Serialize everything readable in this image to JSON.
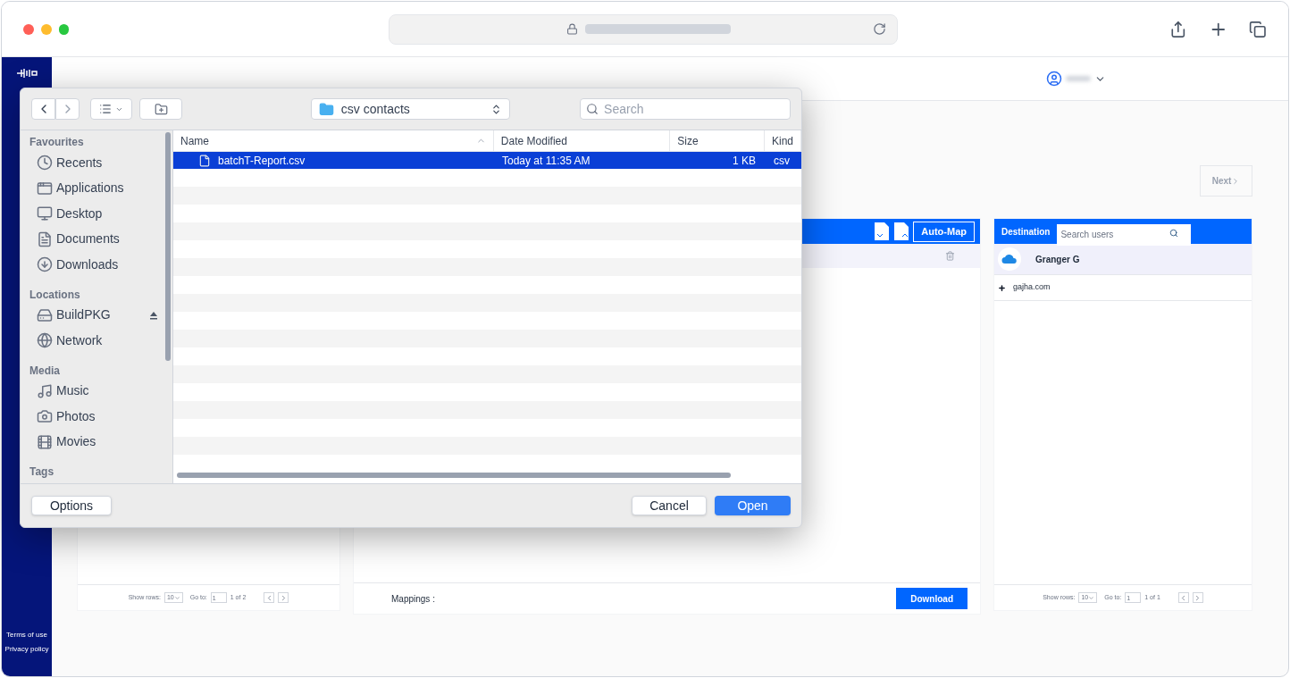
{
  "browser": {
    "address_bar": {
      "secure": true
    }
  },
  "sidebar": {
    "links": [
      "Terms of use",
      "Privacy policy"
    ]
  },
  "header": {
    "user_menu": {
      "expanded": false
    }
  },
  "next_button": {
    "label": "Next",
    "disabled": true
  },
  "source_panel": {
    "pagination": {
      "show_rows_label": "Show rows:",
      "rows": "10",
      "goto_label": "Go to:",
      "page": "1",
      "of": "1 of 2"
    }
  },
  "mapping_panel": {
    "auto_map_label": "Auto-Map",
    "mappings_label": "Mappings :",
    "download_label": "Download"
  },
  "destination_panel": {
    "title": "Destination",
    "search": {
      "placeholder": "Search users"
    },
    "rows": [
      {
        "kind": "user",
        "label": "Granger G",
        "selected": true
      },
      {
        "kind": "domain",
        "label": "gajha.com",
        "selected": false
      }
    ],
    "pagination": {
      "show_rows_label": "Show rows:",
      "rows": "10",
      "goto_label": "Go to:",
      "page": "1",
      "of": "1 of 1"
    }
  },
  "file_dialog": {
    "location": "csv contacts",
    "search": {
      "placeholder": "Search"
    },
    "sidebar": [
      {
        "heading": "Favourites",
        "items": [
          {
            "label": "Recents"
          },
          {
            "label": "Applications"
          },
          {
            "label": "Desktop"
          },
          {
            "label": "Documents"
          },
          {
            "label": "Downloads"
          }
        ]
      },
      {
        "heading": "Locations",
        "items": [
          {
            "label": "BuildPKG",
            "eject": true
          },
          {
            "label": "Network",
            "eject": false
          }
        ]
      },
      {
        "heading": "Media",
        "items": [
          {
            "label": "Music"
          },
          {
            "label": "Photos"
          },
          {
            "label": "Movies"
          }
        ]
      },
      {
        "heading": "Tags"
      }
    ],
    "columns": [
      "Name",
      "Date Modified",
      "Size",
      "Kind"
    ],
    "files": [
      {
        "name": "batchT-Report.csv",
        "date": "Today at 11:35 AM",
        "size": "1 KB",
        "kind": "csv",
        "selected": true
      }
    ],
    "buttons": {
      "options": "Options",
      "cancel": "Cancel",
      "open": "Open"
    }
  }
}
